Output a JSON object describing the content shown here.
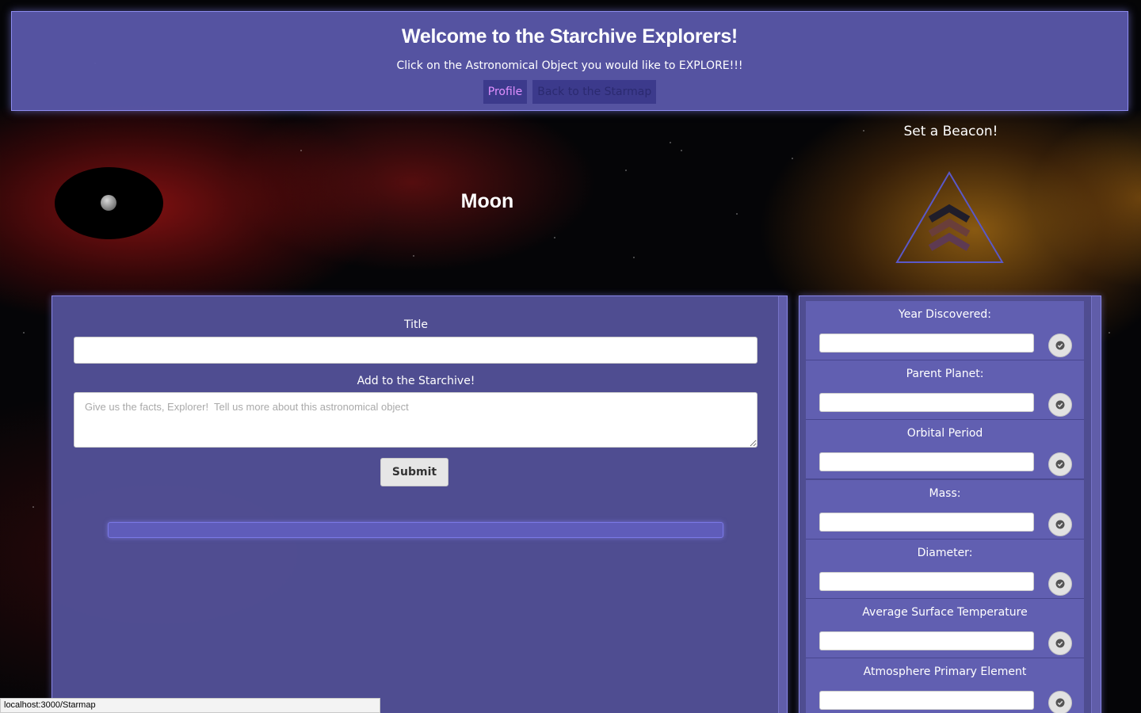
{
  "header": {
    "title": "Welcome to the Starchive Explorers!",
    "subtitle": "Click on the Astronomical Object you would like to EXPLORE!!!",
    "nav": {
      "profile_label": "Profile",
      "starmap_label": "Back to the Starmap"
    }
  },
  "object": {
    "name": "Moon"
  },
  "beacon": {
    "title": "Set a Beacon!"
  },
  "entry_form": {
    "title_label": "Title",
    "title_value": "",
    "content_label": "Add to the Starchive!",
    "content_placeholder": "Give us the facts, Explorer!  Tell us more about this astronomical object",
    "submit_label": "Submit"
  },
  "facts": {
    "items": [
      {
        "label": "Year Discovered:",
        "value": ""
      },
      {
        "label": "Parent Planet:",
        "value": ""
      },
      {
        "label": "Orbital Period",
        "value": ""
      },
      {
        "label": "Mass:",
        "value": ""
      },
      {
        "label": "Diameter:",
        "value": ""
      },
      {
        "label": "Average Surface Temperature",
        "value": ""
      },
      {
        "label": "Atmosphere Primary Element",
        "value": ""
      }
    ]
  },
  "status_bar": {
    "url": "localhost:3000/Starmap"
  },
  "colors": {
    "panel": "#525096",
    "panel_border": "#8886e8",
    "profile_link": "#e090ff",
    "starmap_link": "#2b2a70",
    "red_nebula": "#aa1414",
    "gold_nebula": "#aa6e14"
  }
}
